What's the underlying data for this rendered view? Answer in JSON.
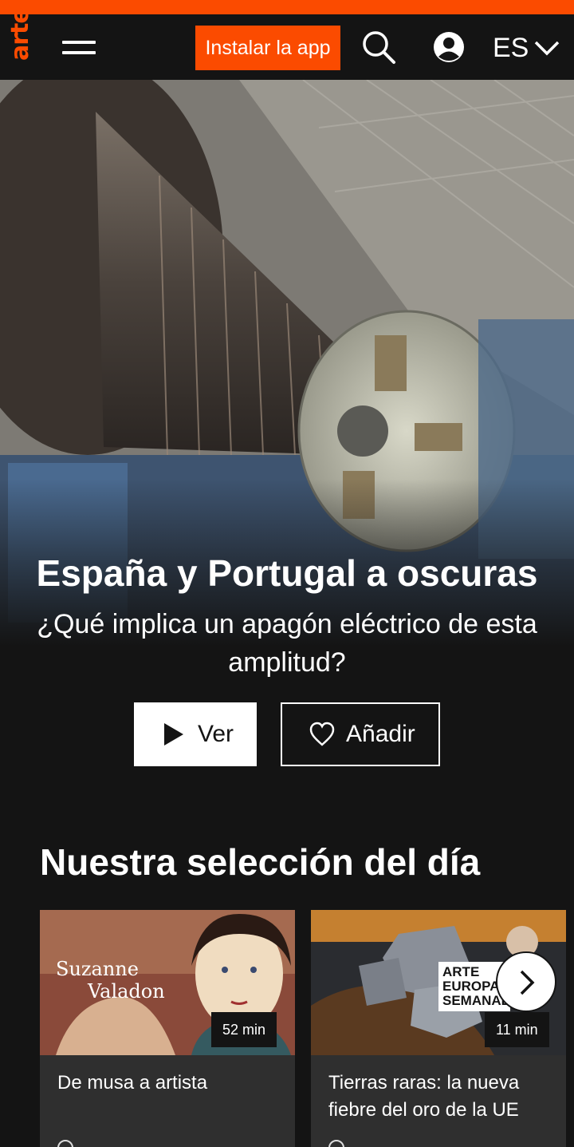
{
  "header": {
    "logo": "arte",
    "install_label": "Instalar la app",
    "language": "ES"
  },
  "hero": {
    "title": "España y Portugal a oscuras",
    "subtitle": "¿Qué implica un apagón eléctrico de esta amplitud?",
    "watch_label": "Ver",
    "add_label": "Añadir"
  },
  "selection": {
    "title": "Nuestra selección del día",
    "cards": [
      {
        "title": "De musa a artista",
        "duration": "52 min",
        "thumb_text": [
          "Suzanne",
          "Valadon"
        ]
      },
      {
        "title": "Tierras raras: la nueva fiebre del oro de la UE",
        "duration": "11 min",
        "thumb_text": [
          "ARTE",
          "EUROPA",
          "SEMANAL"
        ]
      }
    ]
  },
  "colors": {
    "accent": "#fb4b00",
    "background": "#141414",
    "card": "#2f2f2f"
  }
}
